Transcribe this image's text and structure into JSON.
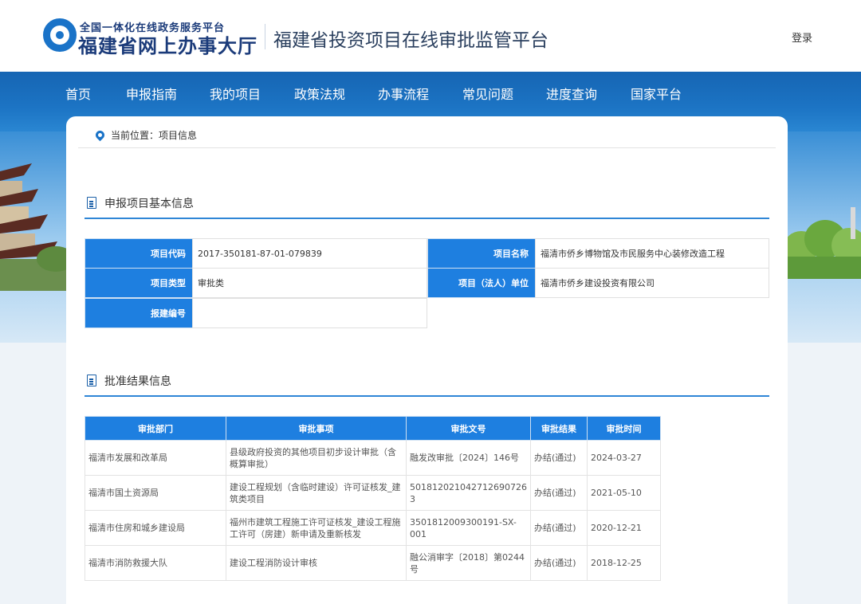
{
  "header": {
    "logo_line1": "全国一体化在线政务服务平台",
    "logo_line2": "福建省网上办事大厅",
    "platform_title": "福建省投资项目在线审批监管平台",
    "login_label": "登录"
  },
  "nav": {
    "items": [
      {
        "label": "首页"
      },
      {
        "label": "申报指南"
      },
      {
        "label": "我的项目"
      },
      {
        "label": "政策法规"
      },
      {
        "label": "办事流程"
      },
      {
        "label": "常见问题"
      },
      {
        "label": "进度查询"
      },
      {
        "label": "国家平台"
      }
    ]
  },
  "breadcrumb": {
    "text": "当前位置：项目信息"
  },
  "basic_info": {
    "title": "申报项目基本信息",
    "fields": {
      "project_code_label": "项目代码",
      "project_code_value": "2017-350181-87-01-079839",
      "project_name_label": "项目名称",
      "project_name_value": "福清市侨乡博物馆及市民服务中心装修改造工程",
      "project_type_label": "项目类型",
      "project_type_value": "审批类",
      "legal_unit_label": "项目（法人）单位",
      "legal_unit_value": "福清市侨乡建设投资有限公司",
      "build_no_label": "报建编号",
      "build_no_value": ""
    }
  },
  "approval": {
    "title": "批准结果信息",
    "columns": [
      "审批部门",
      "审批事项",
      "审批文号",
      "审批结果",
      "审批时间"
    ],
    "rows": [
      {
        "department": "福清市发展和改革局",
        "matter": "县级政府投资的其他项目初步设计审批（含概算审批）",
        "doc_no": "融发改审批〔2024〕146号",
        "result": "办结(通过)",
        "date": "2024-03-27"
      },
      {
        "department": "福清市国土资源局",
        "matter": "建设工程规划（含临时建设）许可证核发_建筑类项目",
        "doc_no": "501812021042712690726​3",
        "result": "办结(通过)",
        "date": "2021-05-10"
      },
      {
        "department": "福清市住房和城乡建设局",
        "matter": "福州市建筑工程施工许可证核发_建设工程施工许可（房建）新申请及重新核发",
        "doc_no": "3501812009300191-SX-001",
        "result": "办结(通过)",
        "date": "2020-12-21"
      },
      {
        "department": "福清市消防救援大队",
        "matter": "建设工程消防设计审核",
        "doc_no": "融公消审字〔2018〕第0244号",
        "result": "办结(通过)",
        "date": "2018-12-25"
      }
    ]
  },
  "colors": {
    "primary_blue": "#1e7fe0",
    "nav_blue": "#1c74c4",
    "brand_navy": "#1b3b7a"
  }
}
